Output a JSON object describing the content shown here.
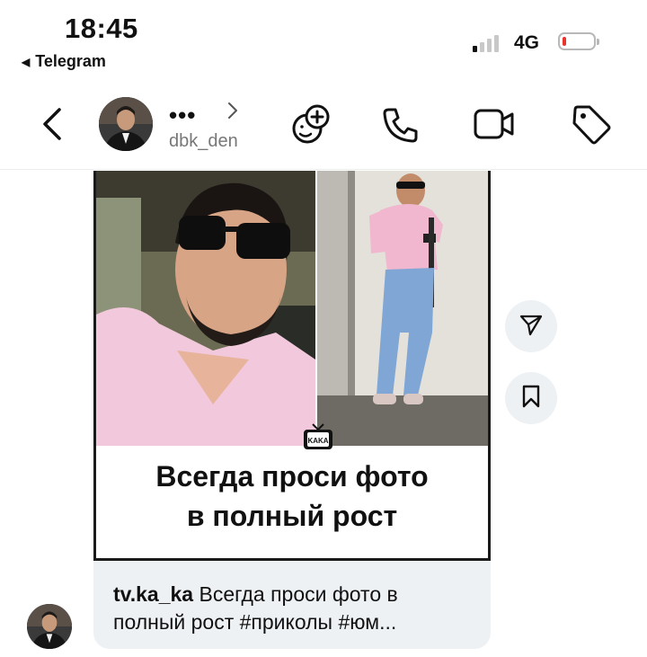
{
  "status_bar": {
    "time": "18:45",
    "back_app": "Telegram",
    "network": "4G",
    "battery_level": 0.12
  },
  "header": {
    "name_masked": "•••",
    "username": "dbk_den",
    "icons": [
      "back-chevron-icon",
      "chevron-right-icon",
      "add-emoji-icon",
      "phone-icon",
      "video-icon",
      "tag-icon"
    ]
  },
  "post": {
    "meme_text_line1": "Всегда проси фото",
    "meme_text_line2": "в полный рост",
    "watermark": "KAKA"
  },
  "caption": {
    "account": "tv.ka_ka",
    "text_line1": " Всегда проси фото в",
    "text_line2": "полный рост #приколы #юм..."
  },
  "side_actions": [
    "share-icon",
    "bookmark-icon"
  ],
  "colors": {
    "battery_low": "#e8342c",
    "bubble": "#eef1f4",
    "shirt_pink": "#f0c6d8",
    "jeans": "#7fa6d4"
  }
}
